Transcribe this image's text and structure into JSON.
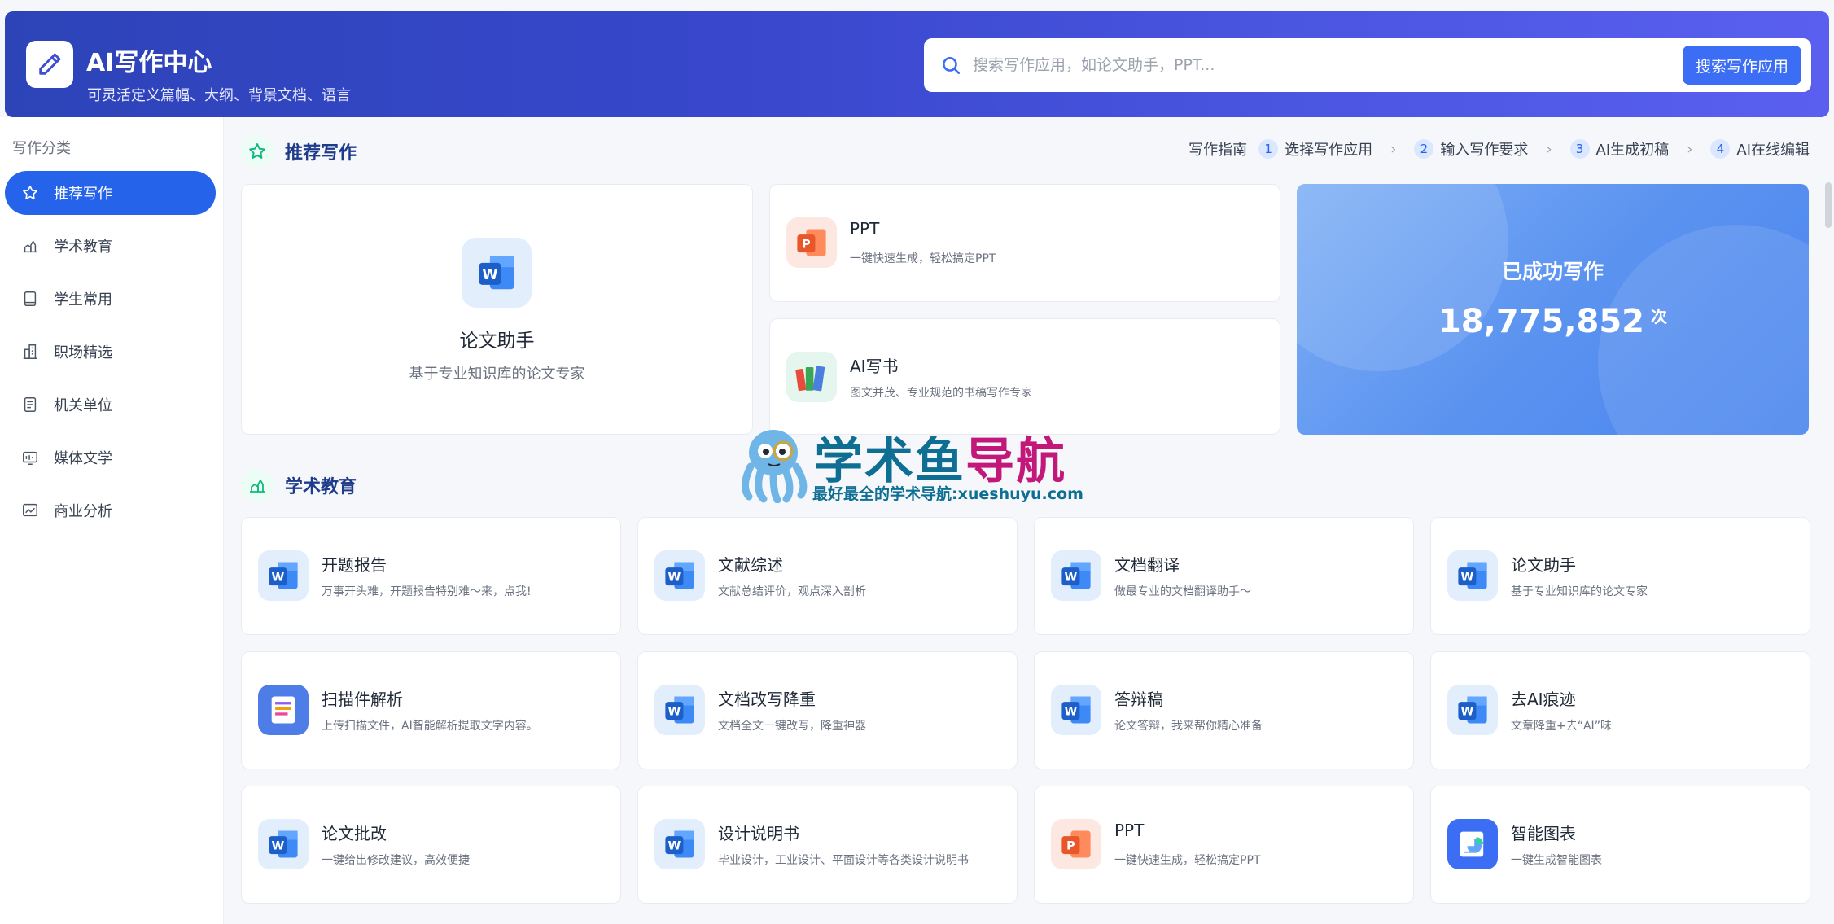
{
  "header": {
    "title": "AI写作中心",
    "subtitle": "可灵活定义篇幅、大纲、背景文档、语言",
    "search_placeholder": "搜索写作应用，如论文助手，PPT...",
    "search_button": "搜索写作应用"
  },
  "sidebar": {
    "heading": "写作分类",
    "items": [
      {
        "label": "推荐写作",
        "icon": "star-icon",
        "active": true
      },
      {
        "label": "学术教育",
        "icon": "academic-icon"
      },
      {
        "label": "学生常用",
        "icon": "book-icon"
      },
      {
        "label": "职场精选",
        "icon": "building-icon"
      },
      {
        "label": "机关单位",
        "icon": "document-icon"
      },
      {
        "label": "媒体文学",
        "icon": "media-icon"
      },
      {
        "label": "商业分析",
        "icon": "chart-icon"
      }
    ]
  },
  "recommend": {
    "title": "推荐写作",
    "guide": {
      "label": "写作指南",
      "steps": [
        {
          "num": "1",
          "text": "选择写作应用"
        },
        {
          "num": "2",
          "text": "输入写作要求"
        },
        {
          "num": "3",
          "text": "AI生成初稿"
        },
        {
          "num": "4",
          "text": "AI在线编辑"
        }
      ]
    },
    "featured": {
      "title": "论文助手",
      "desc": "基于专业知识库的论文专家",
      "icon": "word-icon"
    },
    "cards": [
      {
        "title": "PPT",
        "desc": "一键快速生成，轻松搞定PPT",
        "icon": "ppt-icon"
      },
      {
        "title": "AI写书",
        "desc": "图文并茂、专业规范的书稿写作专家",
        "icon": "books-icon"
      }
    ],
    "stat": {
      "label": "已成功写作",
      "value": "18,775,852",
      "unit": "次"
    }
  },
  "academic": {
    "title": "学术教育",
    "cards": [
      {
        "title": "开题报告",
        "desc": "万事开头难，开题报告特别难～来，点我!",
        "icon": "word-icon"
      },
      {
        "title": "文献综述",
        "desc": "文献总结评价，观点深入剖析",
        "icon": "word-icon"
      },
      {
        "title": "文档翻译",
        "desc": "做最专业的文档翻译助手～",
        "icon": "word-icon"
      },
      {
        "title": "论文助手",
        "desc": "基于专业知识库的论文专家",
        "icon": "word-icon"
      },
      {
        "title": "扫描件解析",
        "desc": "上传扫描文件，AI智能解析提取文字内容。",
        "icon": "scan-icon"
      },
      {
        "title": "文档改写降重",
        "desc": "文档全文一键改写，降重神器",
        "icon": "word-icon"
      },
      {
        "title": "答辩稿",
        "desc": "论文答辩，我来帮你精心准备",
        "icon": "word-icon"
      },
      {
        "title": "去AI痕迹",
        "desc": "文章降重+去“AI”味",
        "icon": "word-icon"
      },
      {
        "title": "论文批改",
        "desc": "一键给出修改建议，高效便捷",
        "icon": "word-icon"
      },
      {
        "title": "设计说明书",
        "desc": "毕业设计，工业设计、平面设计等各类设计说明书",
        "icon": "word-icon"
      },
      {
        "title": "PPT",
        "desc": "一键快速生成，轻松搞定PPT",
        "icon": "ppt-icon"
      },
      {
        "title": "智能图表",
        "desc": "一键生成智能图表",
        "icon": "smart-chart-icon"
      }
    ]
  },
  "watermark": {
    "title_a": "学术鱼",
    "title_b": "导航",
    "subtitle": "最好最全的学术导航:xueshuyu.com"
  }
}
